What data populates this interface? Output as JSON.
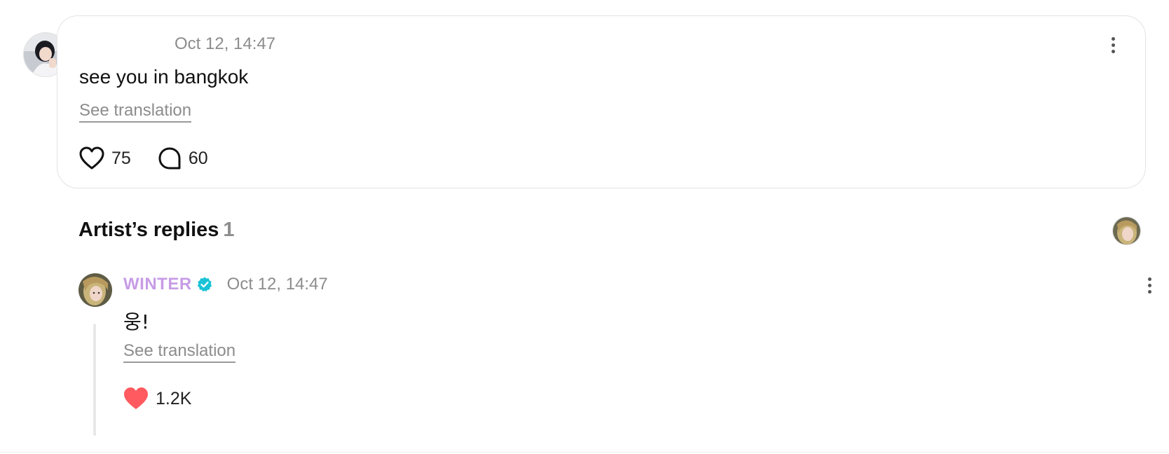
{
  "comment": {
    "timestamp": "Oct 12, 14:47",
    "text": "see you in bangkok",
    "see_translation": "See translation",
    "likes": "75",
    "replies": "60"
  },
  "artist_replies": {
    "title": "Artist’s replies",
    "count": "1",
    "items": [
      {
        "name": "WINTER",
        "timestamp": "Oct 12, 14:47",
        "text": "웅!",
        "see_translation": "See translation",
        "likes": "1.2K"
      }
    ]
  },
  "colors": {
    "artist_name": "#c79ce6",
    "verified_badge": "#19c3d6",
    "liked_heart": "#ff5a5f",
    "muted_text": "#8c8c8c"
  },
  "icons": {
    "more": "more-vertical-icon",
    "like": "heart-outline-icon",
    "reply": "speech-bubble-icon",
    "liked": "heart-filled-icon",
    "verified": "verified-badge-icon"
  }
}
